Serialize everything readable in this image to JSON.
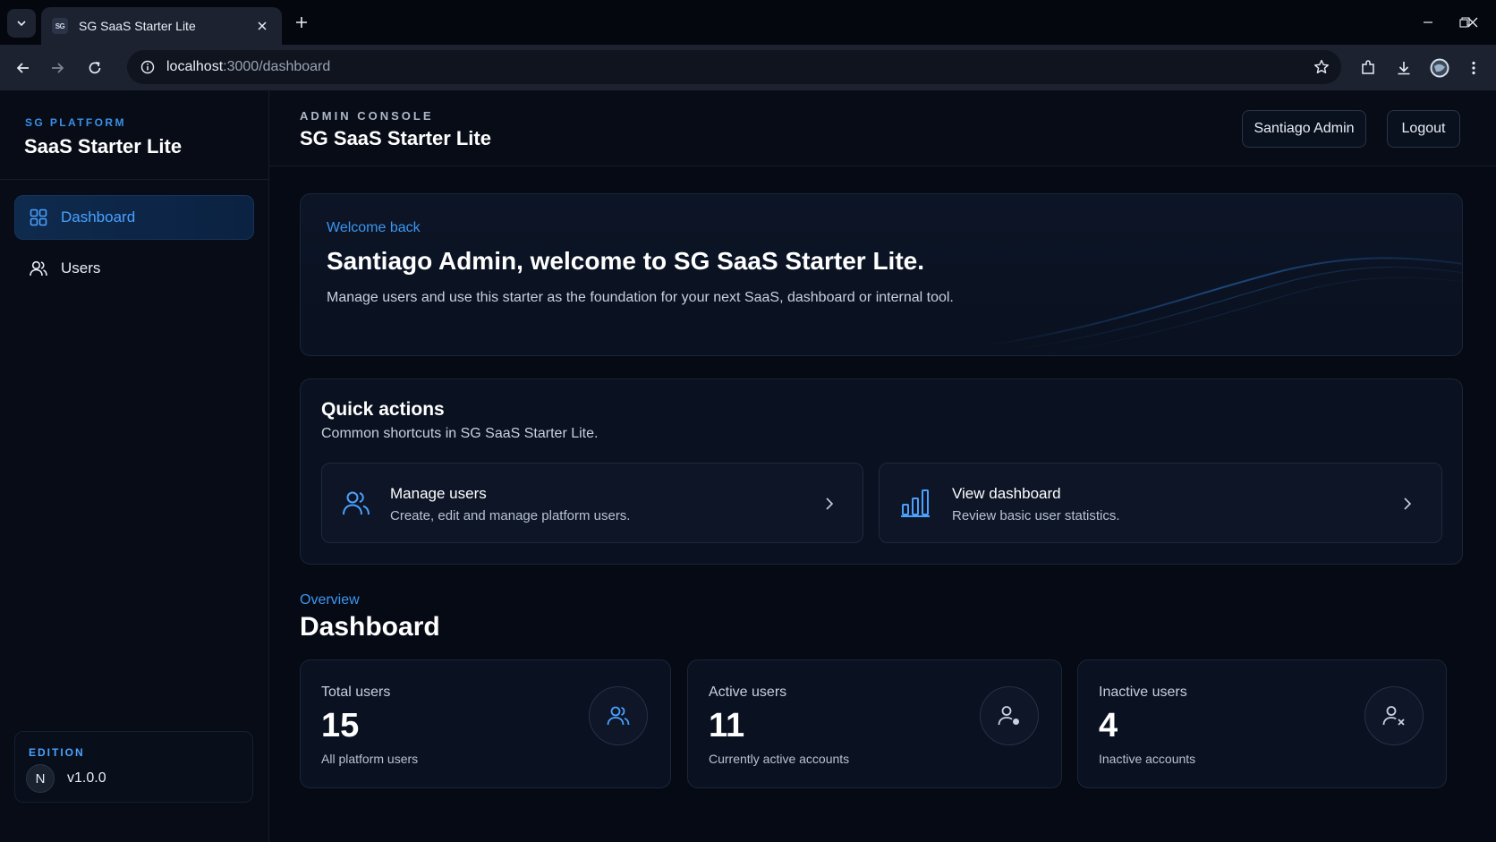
{
  "browser": {
    "tab_title": "SG SaaS Starter Lite",
    "favicon_text": "SG",
    "url_host": "localhost",
    "url_path": ":3000/dashboard"
  },
  "sidebar": {
    "eyebrow": "SG PLATFORM",
    "brand_name": "SaaS Starter Lite",
    "items": [
      {
        "label": "Dashboard",
        "icon": "grid-icon",
        "active": true
      },
      {
        "label": "Users",
        "icon": "users-icon",
        "active": false
      }
    ],
    "edition": {
      "eyebrow": "EDITION",
      "avatar": "N",
      "version": "v1.0.0"
    }
  },
  "topbar": {
    "eyebrow": "ADMIN CONSOLE",
    "title": "SG SaaS Starter Lite",
    "user_button": "Santiago Admin",
    "logout_button": "Logout"
  },
  "welcome": {
    "eyebrow": "Welcome back",
    "title": "Santiago Admin, welcome to SG SaaS Starter Lite.",
    "description": "Manage users and use this starter as the foundation for your next SaaS, dashboard or internal tool."
  },
  "quick_actions": {
    "title": "Quick actions",
    "description": "Common shortcuts in SG SaaS Starter Lite.",
    "items": [
      {
        "title": "Manage users",
        "description": "Create, edit and manage platform users.",
        "icon": "users-icon"
      },
      {
        "title": "View dashboard",
        "description": "Review basic user statistics.",
        "icon": "bar-chart-icon"
      }
    ]
  },
  "overview": {
    "eyebrow": "Overview",
    "title": "Dashboard",
    "stats": [
      {
        "label": "Total users",
        "value": "15",
        "sub": "All platform users",
        "icon": "users-icon"
      },
      {
        "label": "Active users",
        "value": "11",
        "sub": "Currently active accounts",
        "icon": "user-active-icon"
      },
      {
        "label": "Inactive users",
        "value": "4",
        "sub": "Inactive accounts",
        "icon": "user-x-icon"
      }
    ]
  },
  "colors": {
    "accent": "#3b96f2",
    "background": "#060a14",
    "card": "#0a1120"
  }
}
